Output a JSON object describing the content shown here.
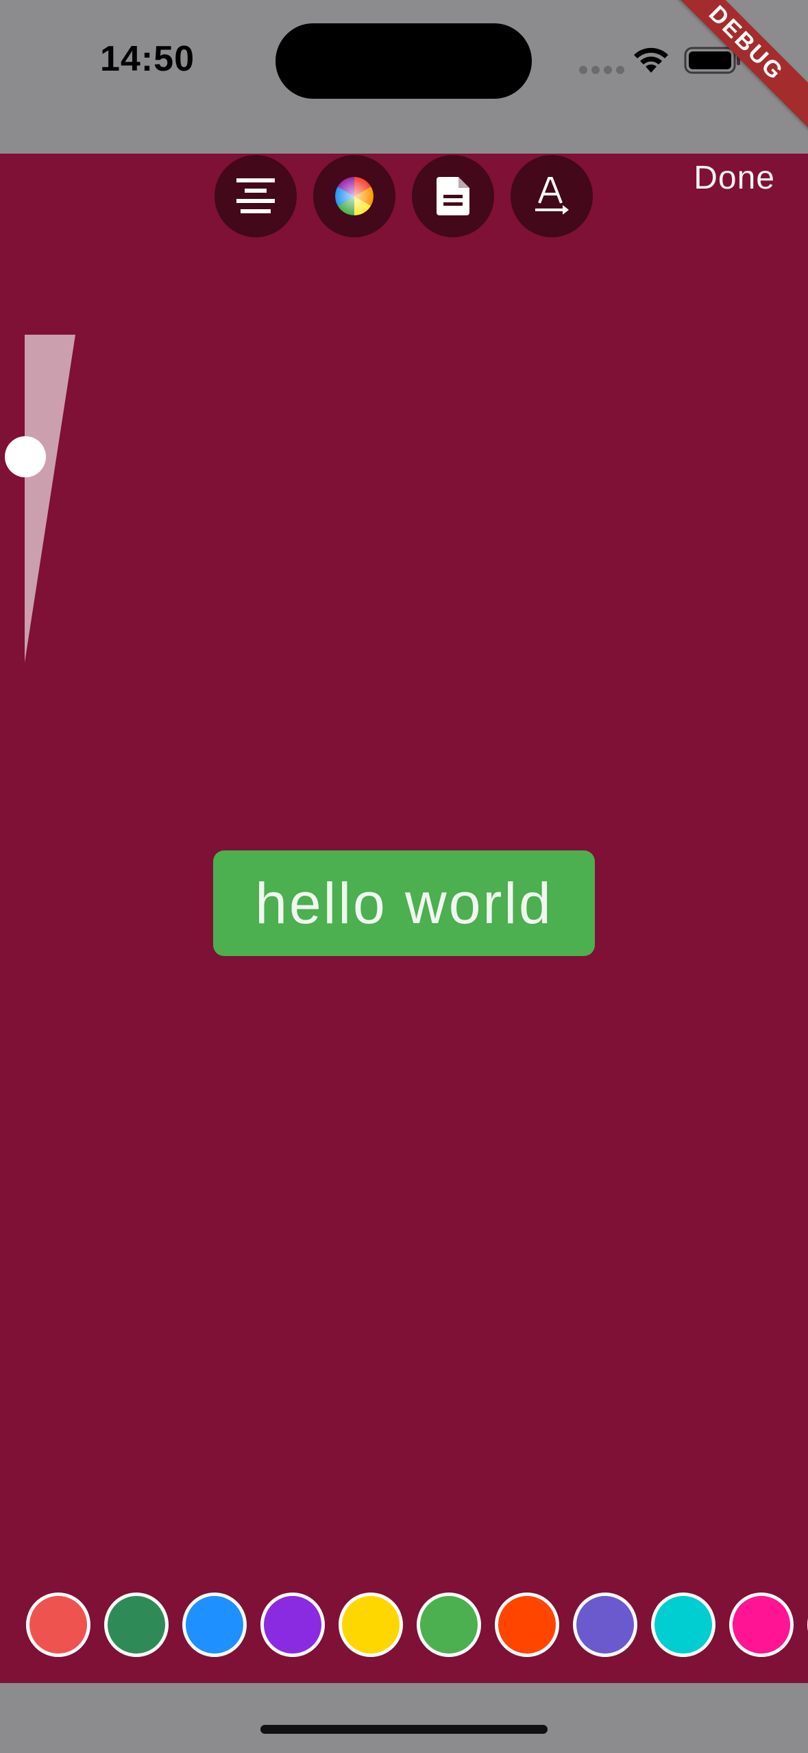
{
  "status_bar": {
    "time": "14:50",
    "debug_label": "DEBUG"
  },
  "toolbar": {
    "buttons": [
      {
        "icon": "align-center-icon"
      },
      {
        "icon": "color-wheel-icon"
      },
      {
        "icon": "document-icon"
      },
      {
        "icon": "text-direction-icon"
      }
    ],
    "done_label": "Done"
  },
  "font_size_slider": {
    "level": 0.31
  },
  "text_element": {
    "text": "hello world",
    "background_color": "#4caf50"
  },
  "colors": {
    "canvas_background": "#7f1036",
    "toolbar_button": "#43081a"
  },
  "palette": {
    "swatches": [
      "#ef5350",
      "#2e8b57",
      "#1e90ff",
      "#8a2be2",
      "#ffd700",
      "#4caf50",
      "#ff4500",
      "#6a5acd",
      "#00ced1",
      "#ff1493",
      "#ffffff"
    ]
  }
}
